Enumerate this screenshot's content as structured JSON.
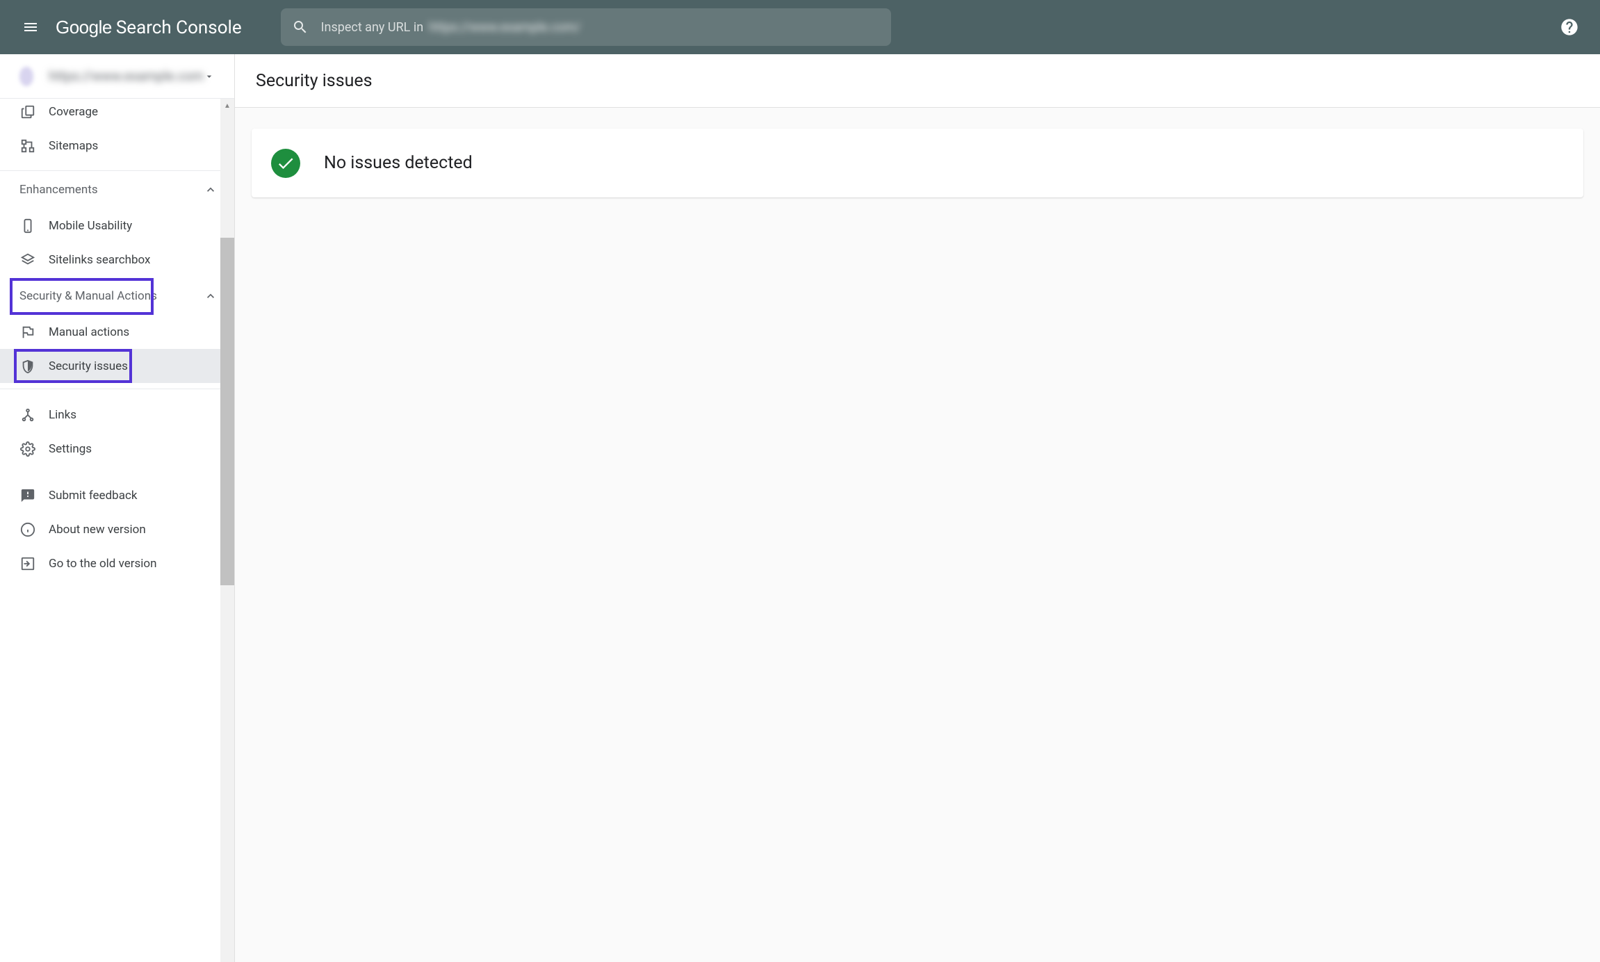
{
  "header": {
    "logo_google": "Google",
    "logo_sc": "Search Console",
    "search_prefix": "Inspect any URL in",
    "search_blurred": "https://www.example.com/"
  },
  "property": {
    "name": "https://www.example.com"
  },
  "sidebar": {
    "coverage": "Coverage",
    "sitemaps": "Sitemaps",
    "enhancements": "Enhancements",
    "mobile_usability": "Mobile Usability",
    "sitelinks_searchbox": "Sitelinks searchbox",
    "security_manual": "Security & Manual Actions",
    "manual_actions": "Manual actions",
    "security_issues": "Security issues",
    "links": "Links",
    "settings": "Settings",
    "submit_feedback": "Submit feedback",
    "about_new": "About new version",
    "old_version": "Go to the old version"
  },
  "main": {
    "title": "Security issues",
    "status": "No issues detected"
  }
}
